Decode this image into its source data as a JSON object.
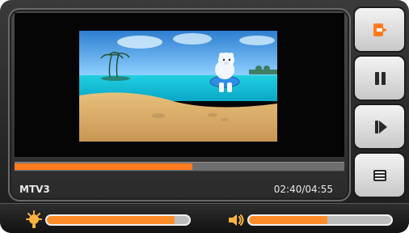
{
  "player": {
    "channel_label": "MTV3",
    "time_readout": "02:40/04:55",
    "playback_progress": 0.54,
    "accent_color": "#ff7b1f"
  },
  "controls": {
    "buttons": [
      {
        "id": "exit",
        "icon": "exit-icon"
      },
      {
        "id": "pause",
        "icon": "pause-icon"
      },
      {
        "id": "step",
        "icon": "step-forward-icon"
      },
      {
        "id": "menu",
        "icon": "list-menu-icon"
      }
    ]
  },
  "sliders": {
    "brightness": {
      "icon": "brightness-icon",
      "level": 0.9
    },
    "volume": {
      "icon": "volume-icon",
      "level": 0.55
    }
  },
  "colors": {
    "background": "#1b1b1b",
    "panel": "#2a2a2a",
    "button_bg": "#e6e6e6",
    "text": "#e8e8e8",
    "accent": "#ff7b1f"
  }
}
